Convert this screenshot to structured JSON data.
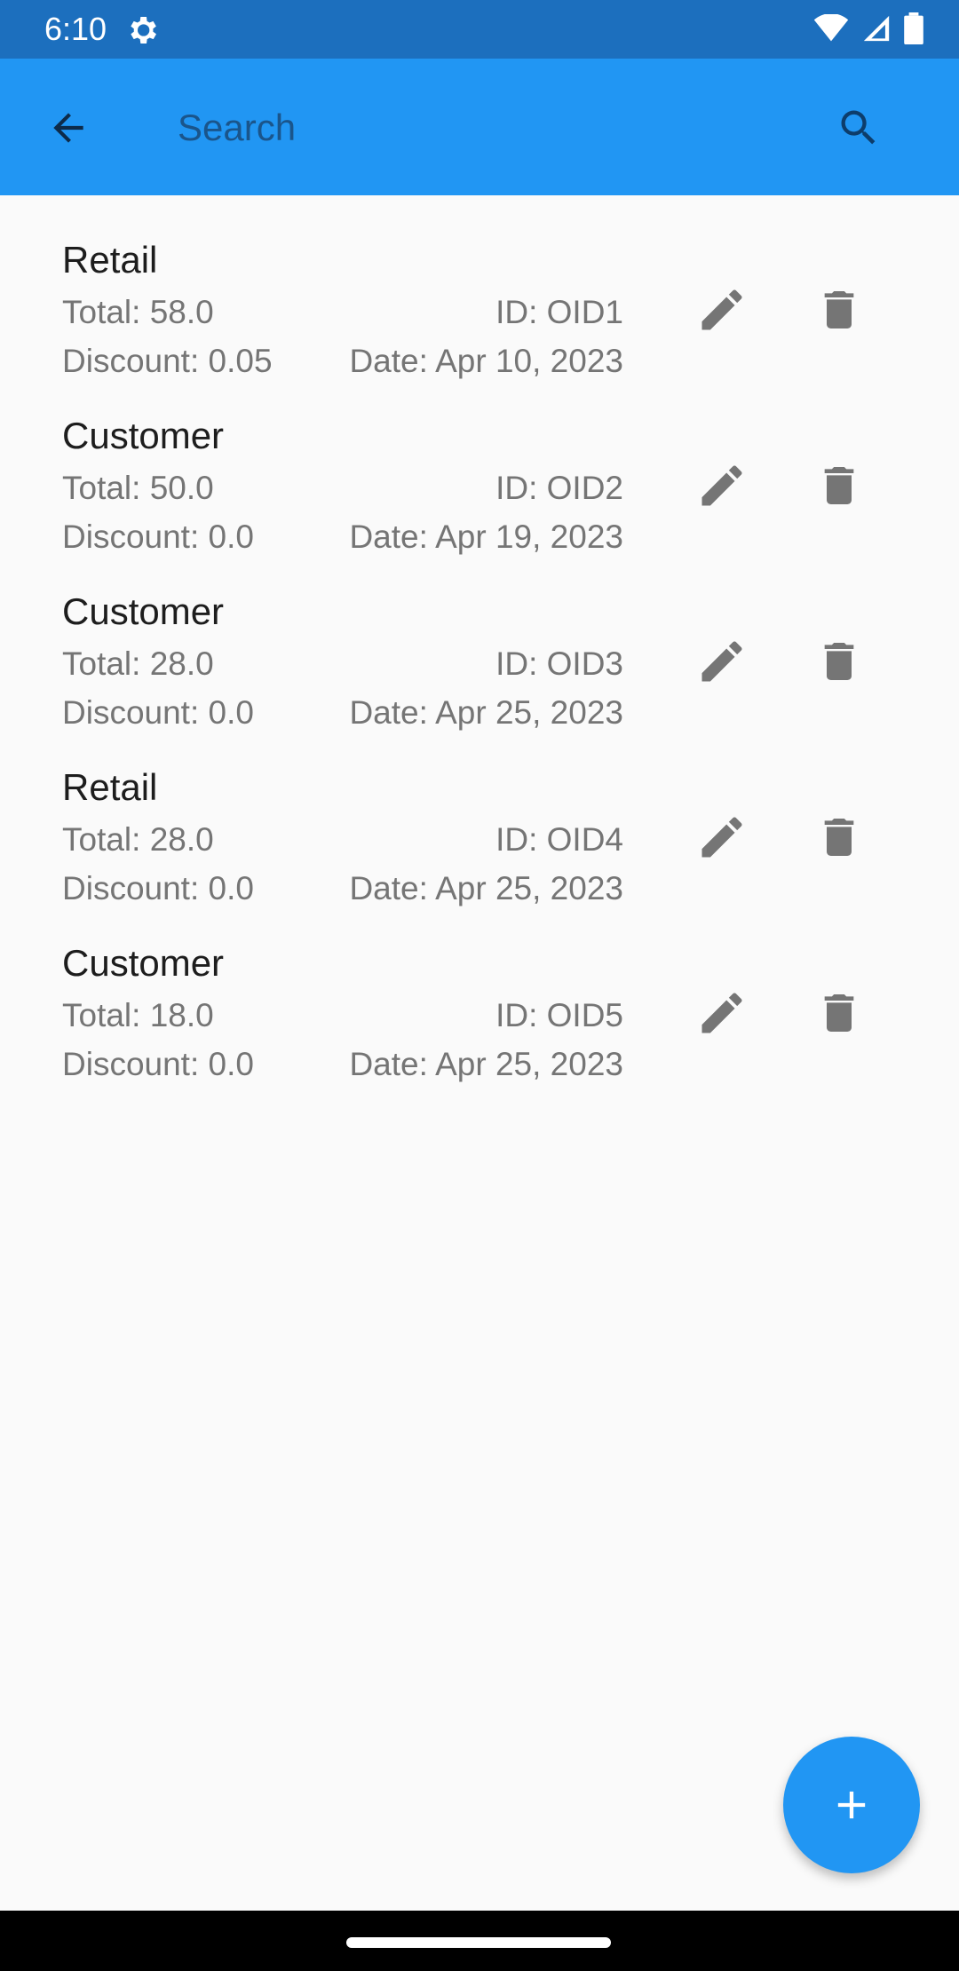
{
  "status_bar": {
    "time": "6:10"
  },
  "search": {
    "placeholder": "Search",
    "value": ""
  },
  "orders": [
    {
      "type": "Retail",
      "total": "Total: 58.0",
      "discount": "Discount: 0.05",
      "id": "ID: OID1",
      "date": "Date: Apr 10, 2023"
    },
    {
      "type": "Customer",
      "total": "Total: 50.0",
      "discount": "Discount: 0.0",
      "id": "ID: OID2",
      "date": "Date: Apr 19, 2023"
    },
    {
      "type": "Customer",
      "total": "Total: 28.0",
      "discount": "Discount: 0.0",
      "id": "ID: OID3",
      "date": "Date: Apr 25, 2023"
    },
    {
      "type": "Retail",
      "total": "Total: 28.0",
      "discount": "Discount: 0.0",
      "id": "ID: OID4",
      "date": "Date: Apr 25, 2023"
    },
    {
      "type": "Customer",
      "total": "Total: 18.0",
      "discount": "Discount: 0.0",
      "id": "ID: OID5",
      "date": "Date: Apr 25, 2023"
    }
  ],
  "icons": {
    "back": "arrow-back-icon",
    "search": "search-icon",
    "edit": "pencil-icon",
    "delete": "trash-icon",
    "add": "plus-icon"
  },
  "colors": {
    "app_bar": "#2196f3",
    "status_bar": "#1c6fbe",
    "fab": "#2196f3",
    "icon_gray": "#757575"
  }
}
